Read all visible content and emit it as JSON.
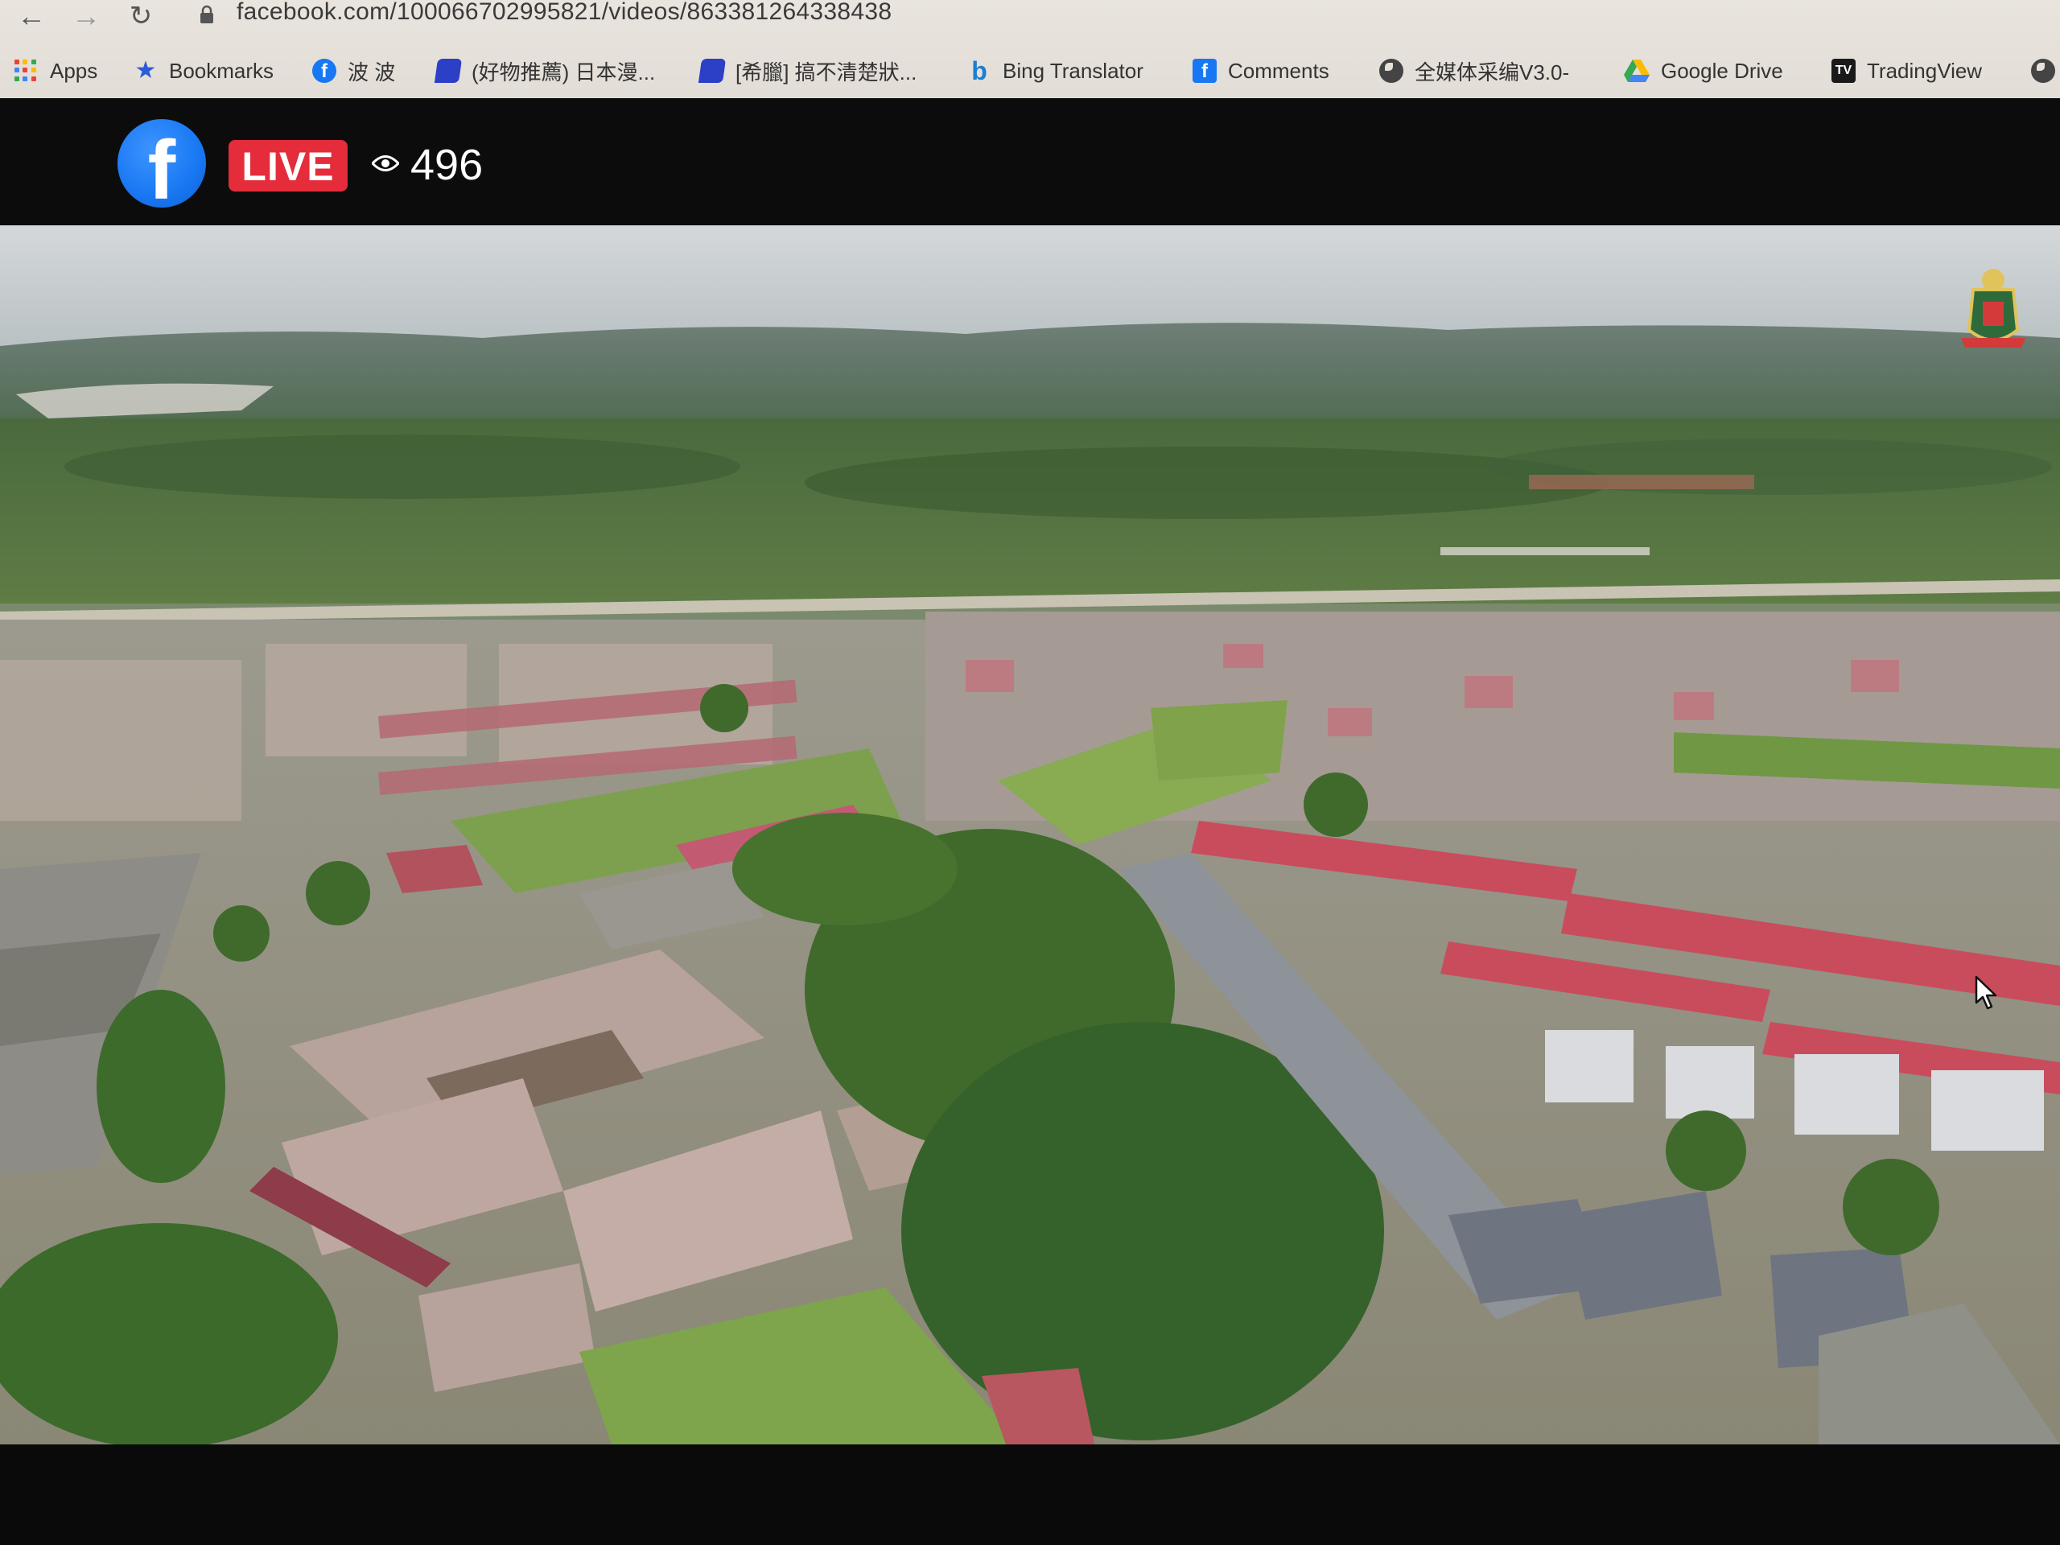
{
  "browser": {
    "url": "facebook.com/100066702995821/videos/863381264338438",
    "bookmarks": [
      {
        "label": "Apps",
        "icon": "apps-grid-icon"
      },
      {
        "label": "Bookmarks",
        "icon": "star-icon"
      },
      {
        "label": "波 波",
        "icon": "facebook-icon"
      },
      {
        "label": "(好物推薦) 日本漫...",
        "icon": "chat-bubble-icon"
      },
      {
        "label": "[希臘] 搞不清楚狀...",
        "icon": "chat-bubble-icon"
      },
      {
        "label": "Bing Translator",
        "icon": "bing-icon"
      },
      {
        "label": "Comments",
        "icon": "facebook-square-icon"
      },
      {
        "label": "全媒体采编V3.0-",
        "icon": "globe-icon"
      },
      {
        "label": "Google Drive",
        "icon": "google-drive-icon"
      },
      {
        "label": "TradingView",
        "icon": "tradingview-icon"
      }
    ],
    "tradingview_glyph": "TV"
  },
  "player": {
    "brand_glyph": "f",
    "live_label": "LIVE",
    "viewer_count": "496"
  },
  "colors": {
    "live_red": "#e42c3a",
    "facebook_blue": "#1877f2"
  }
}
